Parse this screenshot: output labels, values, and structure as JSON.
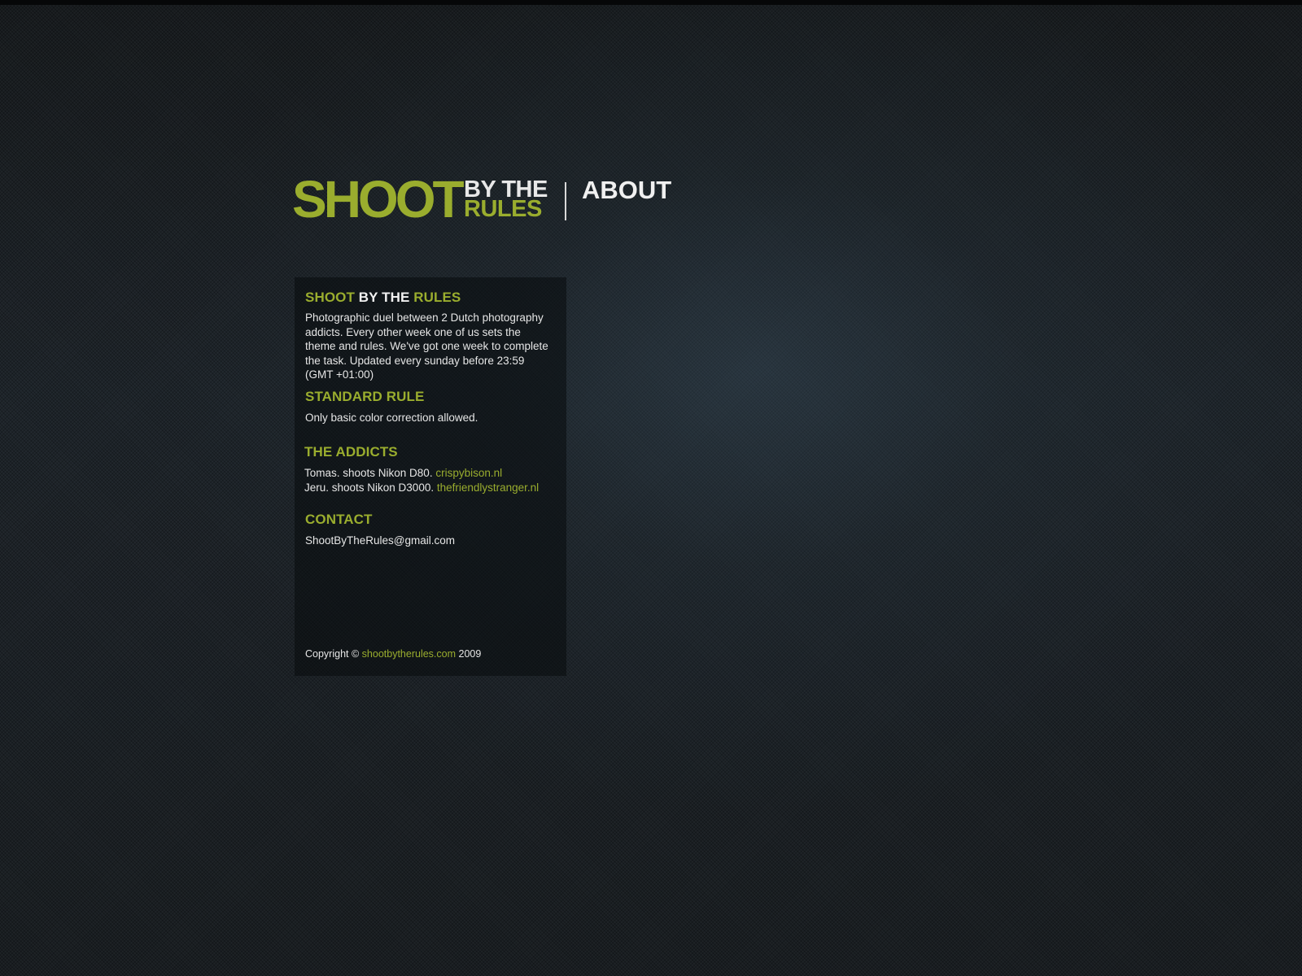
{
  "header": {
    "logo": {
      "shoot": "SHOOT",
      "by_the": "BY THE",
      "rules": "RULES"
    },
    "nav": {
      "about_label": "ABOUT"
    }
  },
  "panel": {
    "intro": {
      "title_shoot": "SHOOT",
      "title_by_the": "BY THE",
      "title_rules": "RULES",
      "text": "Photographic duel between 2 Dutch photography addicts. Every other week one of us sets the theme and rules. We've got one week to complete the task. Updated every sunday before 23:59 (GMT +01:00)"
    },
    "standard_rule": {
      "title": "STANDARD RULE",
      "text": "Only basic color correction allowed."
    },
    "addicts": {
      "title": "THE ADDICTS",
      "people": [
        {
          "text": "Tomas. shoots Nikon D80.",
          "link": "crispybison.nl"
        },
        {
          "text": "Jeru. shoots Nikon D3000.",
          "link": "thefriendlystranger.nl"
        }
      ]
    },
    "contact": {
      "title": "CONTACT",
      "email": "ShootByTheRules@gmail.com"
    },
    "copyright": {
      "prefix": "Copyright ©",
      "link": "shootbytherules.com",
      "year": "2009"
    }
  },
  "colors": {
    "accent": "#9aad2e",
    "text": "#e6e6e6",
    "background": "#1a2025"
  }
}
